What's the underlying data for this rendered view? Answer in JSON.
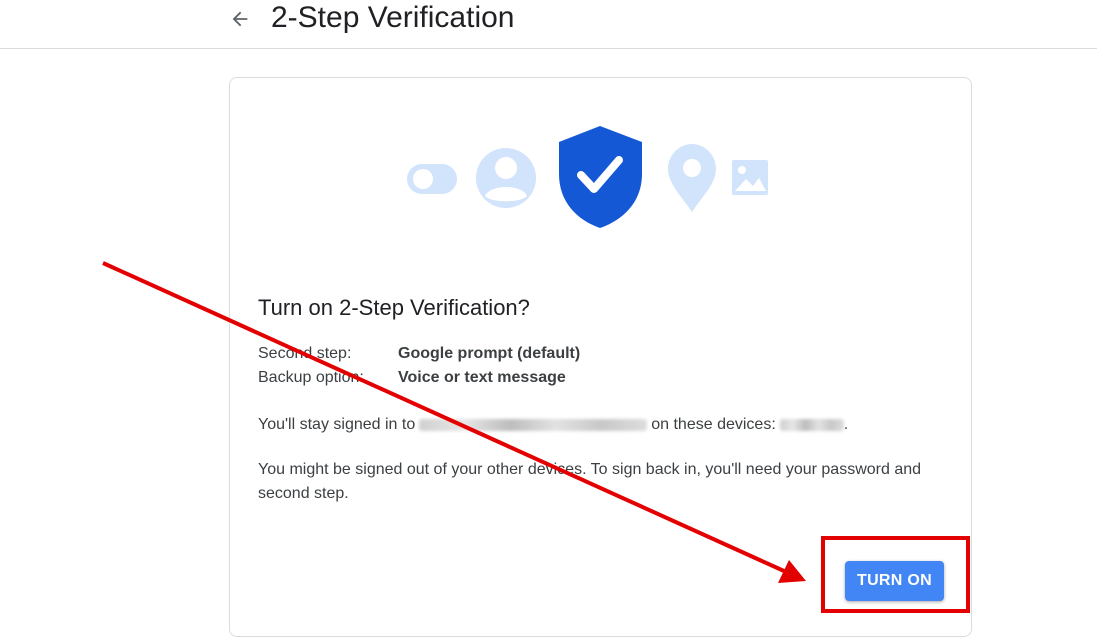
{
  "header": {
    "title": "2-Step Verification",
    "back_icon": "arrow-back-icon"
  },
  "illustration": {
    "icons": [
      "toggle-icon",
      "account-circle-icon",
      "shield-check-icon",
      "location-pin-icon",
      "image-icon"
    ],
    "colors": {
      "light": "#d2e3fc",
      "shield": "#1558d6"
    }
  },
  "card": {
    "title": "Turn on 2-Step Verification?",
    "rows": [
      {
        "label": "Second step:",
        "value": "Google prompt (default)"
      },
      {
        "label": "Backup option:",
        "value": "Voice or text message"
      }
    ],
    "stay_signed_prefix": "You'll stay signed in to",
    "stay_signed_middle": "on these devices:",
    "stay_signed_suffix": ".",
    "warning": "You might be signed out of your other devices. To sign back in, you'll need your password and second step.",
    "button_label": "TURN ON"
  },
  "annotation": {
    "color": "#e30000"
  }
}
